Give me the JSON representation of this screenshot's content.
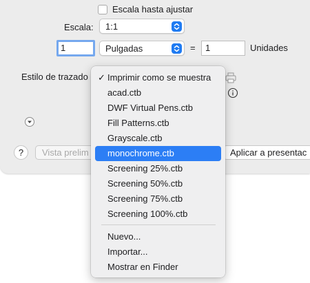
{
  "dialog": {
    "scale_to_fit_label": "Escala hasta ajustar",
    "scale_label": "Escala:",
    "scale_value": "1:1",
    "inches_value": "1",
    "unit_value": "Pulgadas",
    "equals": "=",
    "units_value": "1",
    "units_label": "Unidades",
    "plot_style_label": "Estilo de trazado",
    "help_label": "?",
    "preview_button": "Vista prelim",
    "apply_button": "Aplicar a presentac"
  },
  "menu": {
    "items": [
      {
        "label": "Imprimir como se muestra",
        "checked": true
      },
      {
        "label": "acad.ctb"
      },
      {
        "label": "DWF Virtual Pens.ctb"
      },
      {
        "label": "Fill Patterns.ctb"
      },
      {
        "label": "Grayscale.ctb"
      },
      {
        "label": "monochrome.ctb",
        "selected": true
      },
      {
        "label": "Screening 25%.ctb"
      },
      {
        "label": "Screening 50%.ctb"
      },
      {
        "label": "Screening 75%.ctb"
      },
      {
        "label": "Screening 100%.ctb"
      }
    ],
    "actions": [
      {
        "label": "Nuevo..."
      },
      {
        "label": "Importar..."
      },
      {
        "label": "Mostrar en Finder"
      }
    ],
    "check_mark": "✓"
  },
  "colors": {
    "accent": "#2c7ef5",
    "stepper": "#1f7bf2",
    "focus_ring": "#75a8ee"
  }
}
